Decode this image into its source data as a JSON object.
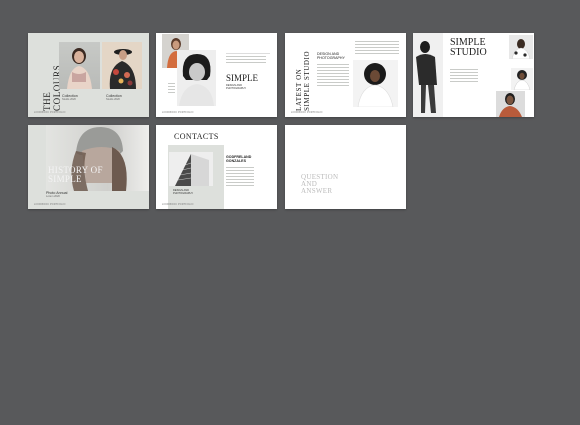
{
  "colors": {
    "background": "#58595b",
    "slide": "#ffffff",
    "sage": "#dde0dc",
    "text": "#222222"
  },
  "slides": [
    {
      "title": "THE COLOURS",
      "caption_left_title": "Collection",
      "caption_left_sub": "Studio 2020",
      "caption_right_title": "Collection",
      "caption_right_sub": "Studio 2020",
      "footer": "LOOKBOOK PORTFOLIO"
    },
    {
      "title": "SIMPLE",
      "subtitle_1": "DESIGN AND",
      "subtitle_2": "PHOTOGRAPHY",
      "footer": "LOOKBOOK PORTFOLIO"
    },
    {
      "title": "LATEST ON SIMPLE STUDIO",
      "heading_1": "DESIGN AND",
      "heading_2": "PHOTOGRAPHY",
      "footer": "LOOKBOOK PORTFOLIO"
    },
    {
      "title_1": "SIMPLE",
      "title_2": "STUDIO"
    },
    {
      "title_1": "HISTORY OF",
      "title_2": "SIMPLE",
      "caption_1": "Photo Annual",
      "caption_2": "Lorem 2020",
      "footer": "LOOKBOOK PORTFOLIO"
    },
    {
      "title": "CONTACTS",
      "name_1": "GODFRELAND",
      "name_2": "GONZALES",
      "label_1": "DESIGN AND",
      "label_2": "PHOTOGRAPHY",
      "footer": "LOOKBOOK PORTFOLIO"
    },
    {
      "title_1": "QUESTION",
      "title_2": "AND",
      "title_3": "ANSWER"
    }
  ]
}
